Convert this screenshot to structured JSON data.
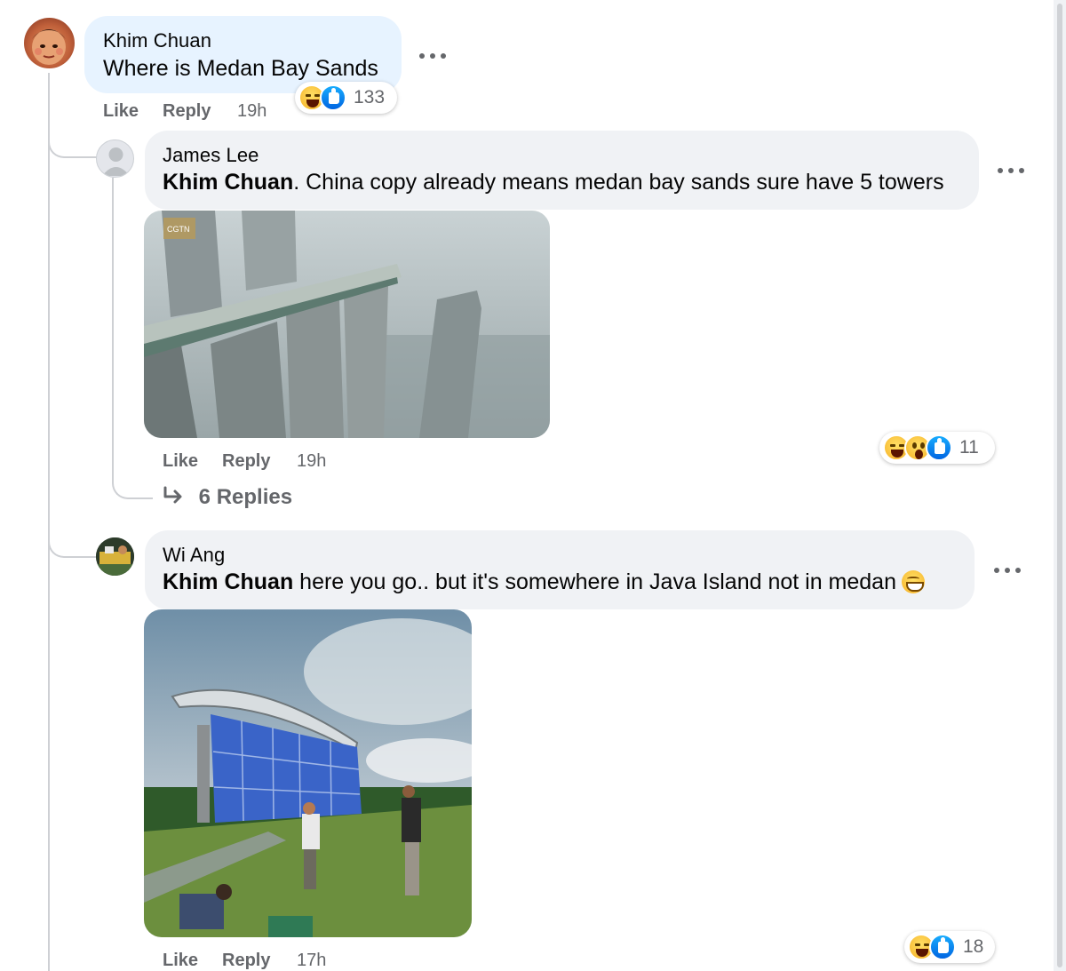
{
  "comments": [
    {
      "author": "Khim Chuan",
      "text": "Where is Medan Bay Sands",
      "actions": {
        "like": "Like",
        "reply": "Reply",
        "time": "19h"
      },
      "reactions": {
        "types": [
          "haha",
          "like"
        ],
        "count": "133"
      },
      "avatar_icon": "profile-photo"
    },
    {
      "author": "James Lee",
      "mention": "Khim Chuan",
      "text": ". China copy already means medan bay sands sure have 5 towers",
      "actions": {
        "like": "Like",
        "reply": "Reply",
        "time": "19h"
      },
      "reactions": {
        "types": [
          "haha",
          "wow",
          "like"
        ],
        "count": "11"
      },
      "photo": {
        "watermark": "CGTN"
      },
      "replies_link": "6 Replies",
      "avatar_icon": "default-avatar-icon"
    },
    {
      "author": "Wi Ang",
      "mention": "Khim Chuan",
      "text": " here you go.. but it's somewhere in Java Island not in medan",
      "actions": {
        "like": "Like",
        "reply": "Reply",
        "time": "17h"
      },
      "reactions": {
        "types": [
          "haha",
          "like"
        ],
        "count": "18"
      },
      "avatar_icon": "profile-photo"
    }
  ],
  "colors": {
    "bubble": "#f0f2f5",
    "bubble_highlight": "#e7f3ff",
    "secondary_text": "#65676b",
    "like_blue": "#0165e1",
    "haha_yellow": "#f7b125"
  }
}
